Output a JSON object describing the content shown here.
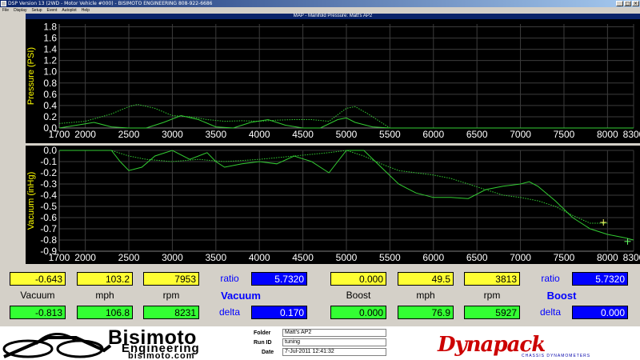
{
  "window": {
    "title": "DSP Version 13 (2WD - Motor Vehicle #000) - BISIMOTO ENGINEERING 808-922-6686",
    "minimize": "_",
    "maximize": "□",
    "close": "×"
  },
  "menu": [
    "File",
    "Display",
    "Setup",
    "Event",
    "Autoplot",
    "Help"
  ],
  "chart_title": "MAP - Manifold Pressure: Matt's AP2",
  "chart_data": [
    {
      "type": "line",
      "ylabel": "Pressure (PSI)",
      "xlim": [
        1700,
        8300
      ],
      "ylim": [
        0,
        1.85
      ],
      "x_ticks": [
        "1700",
        "2000",
        "2500",
        "3000",
        "3500",
        "4000",
        "4500",
        "5000",
        "5500",
        "6000",
        "6500",
        "7000",
        "7500",
        "8000",
        "8300"
      ],
      "y_ticks": [
        "1.8",
        "1.6",
        "1.4",
        "1.2",
        "1.0",
        "0.8",
        "0.6",
        "0.4",
        "0.2",
        "0.0"
      ],
      "grid": true,
      "series": [
        {
          "style": "dotted",
          "x": [
            1700,
            2000,
            2300,
            2500,
            2600,
            2800,
            3000,
            3200,
            3400,
            3600,
            3800,
            4000,
            4200,
            4400,
            4600,
            4800,
            5000,
            5100,
            5250,
            5400,
            5500
          ],
          "y": [
            0.08,
            0.12,
            0.25,
            0.38,
            0.42,
            0.35,
            0.22,
            0.2,
            0.15,
            0.12,
            0.13,
            0.12,
            0.14,
            0.15,
            0.15,
            0.12,
            0.35,
            0.38,
            0.25,
            0.1,
            0.0
          ]
        },
        {
          "style": "solid",
          "x": [
            1700,
            1900,
            2100,
            2300,
            2500,
            2700,
            2900,
            3100,
            3300,
            3500,
            3700,
            3900,
            4100,
            4300,
            4500,
            4700,
            4900,
            5000,
            5100,
            5300,
            5500,
            8300
          ],
          "y": [
            0.0,
            0.05,
            0.1,
            0.02,
            0.0,
            0.0,
            0.1,
            0.22,
            0.15,
            0.02,
            0.0,
            0.1,
            0.15,
            0.05,
            0.0,
            0.0,
            0.15,
            0.18,
            0.1,
            0.02,
            0.0,
            0.0
          ]
        }
      ]
    },
    {
      "type": "line",
      "ylabel": "Vacuum (inHg)",
      "xlim": [
        1700,
        8300
      ],
      "ylim": [
        -0.9,
        0.0
      ],
      "x_ticks": [
        "1700",
        "2000",
        "2500",
        "3000",
        "3500",
        "4000",
        "4500",
        "5000",
        "5500",
        "6000",
        "6500",
        "7000",
        "7500",
        "8000",
        "8300"
      ],
      "y_ticks": [
        "0.0",
        "-0.1",
        "-0.2",
        "-0.3",
        "-0.4",
        "-0.5",
        "-0.6",
        "-0.7",
        "-0.8",
        "-0.9"
      ],
      "grid": true,
      "series": [
        {
          "style": "solid",
          "x": [
            1700,
            2300,
            2400,
            2500,
            2650,
            2800,
            3000,
            3200,
            3400,
            3500,
            3600,
            3800,
            4000,
            4200,
            4400,
            4600,
            4800,
            5000,
            5200,
            5400,
            5600,
            5800,
            6000,
            6200,
            6400,
            6600,
            6800,
            7000,
            7100,
            7200,
            7400,
            7600,
            7700,
            7800,
            8000,
            8200,
            8300
          ],
          "y": [
            0.0,
            0.0,
            -0.1,
            -0.18,
            -0.15,
            -0.05,
            0.0,
            -0.08,
            -0.02,
            -0.1,
            -0.15,
            -0.12,
            -0.1,
            -0.12,
            -0.05,
            -0.1,
            -0.2,
            0.0,
            0.0,
            -0.15,
            -0.3,
            -0.38,
            -0.42,
            -0.42,
            -0.43,
            -0.35,
            -0.32,
            -0.3,
            -0.28,
            -0.32,
            -0.45,
            -0.6,
            -0.65,
            -0.7,
            -0.75,
            -0.78,
            -0.8
          ]
        },
        {
          "style": "dotted",
          "x": [
            1700,
            2300,
            2500,
            2700,
            3000,
            3300,
            3600,
            4000,
            4400,
            4800,
            5000,
            5200,
            5400,
            5600,
            5800,
            6000,
            6200,
            6400,
            6600,
            6800,
            7000,
            7200,
            7400,
            7600,
            7800,
            8000
          ],
          "y": [
            0.0,
            0.0,
            -0.05,
            -0.08,
            -0.1,
            -0.08,
            -0.1,
            -0.08,
            -0.05,
            -0.02,
            0.0,
            -0.05,
            -0.12,
            -0.18,
            -0.2,
            -0.22,
            -0.25,
            -0.3,
            -0.35,
            -0.4,
            -0.42,
            -0.45,
            -0.5,
            -0.58,
            -0.65,
            -0.65
          ]
        }
      ]
    }
  ],
  "readout": {
    "vacuum_row": {
      "val1": "-0.643",
      "mph": "103.2",
      "rpm": "7953",
      "ratio_label": "ratio",
      "ratio": "5.7320",
      "label_vacuum": "Vacuum",
      "label_mph": "mph",
      "label_rpm": "rpm",
      "section": "Vacuum",
      "val2": "-0.813",
      "mph2": "106.8",
      "rpm2": "8231",
      "delta_label": "delta",
      "delta": "0.170"
    },
    "boost_row": {
      "val1": "0.000",
      "mph": "49.5",
      "rpm": "3813",
      "ratio_label": "ratio",
      "ratio": "5.7320",
      "label_boost": "Boost",
      "label_mph": "mph",
      "label_rpm": "rpm",
      "section": "Boost",
      "val2": "0.000",
      "mph2": "76.9",
      "rpm2": "5927",
      "delta_label": "delta",
      "delta": "0.000"
    }
  },
  "footer": {
    "brand": "Bisimoto",
    "brand_sub": "Engineering",
    "brand_url": "bisimoto.com",
    "folder_label": "Folder",
    "folder": "Matt's AP2",
    "run_label": "Run ID",
    "run": "tuning",
    "date_label": "Date",
    "date": "7-Jul-2011 12:41:32",
    "dynapack": "Dynapack",
    "dynapack_sub": "CHASSIS DYNAMOMETERS"
  },
  "colors": {
    "axis_text": "#ffffff",
    "ylabel_text": "#ffff00",
    "grid": "#3c3c3c",
    "trace": "#33cc33"
  }
}
